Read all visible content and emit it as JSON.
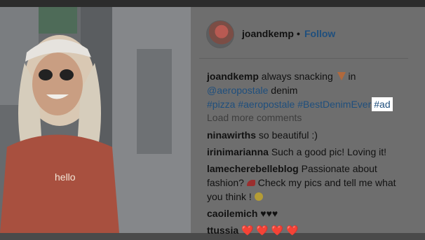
{
  "post": {
    "user": "joandkemp",
    "dot": "•",
    "follow": "Follow"
  },
  "caption": {
    "user": "joandkemp",
    "text1": "always snacking",
    "text2": "in",
    "mention": "@aeropostale",
    "text3": "denim",
    "tags": "#pizza #aeropostale #BestDenimEver",
    "ad_tag": "#ad"
  },
  "load_more": "Load more comments",
  "comments": [
    {
      "user": "ninawirths",
      "text": "so beautiful :)"
    },
    {
      "user": "irinimarianna",
      "text": "Such a good pic! Loving it!"
    },
    {
      "user": "lamecherebelleblog",
      "text1": "Passionate about fashion?",
      "text2": "Check my pics and tell me what you think !"
    },
    {
      "user": "caoilemich",
      "text": "♥♥♥"
    },
    {
      "user": "ttussia",
      "text": "❤️ ❤️ ❤️ ❤️"
    }
  ],
  "icons": [
    "pizza-emoji-icon",
    "smile-emoji-icon",
    "high-heel-emoji-icon"
  ]
}
